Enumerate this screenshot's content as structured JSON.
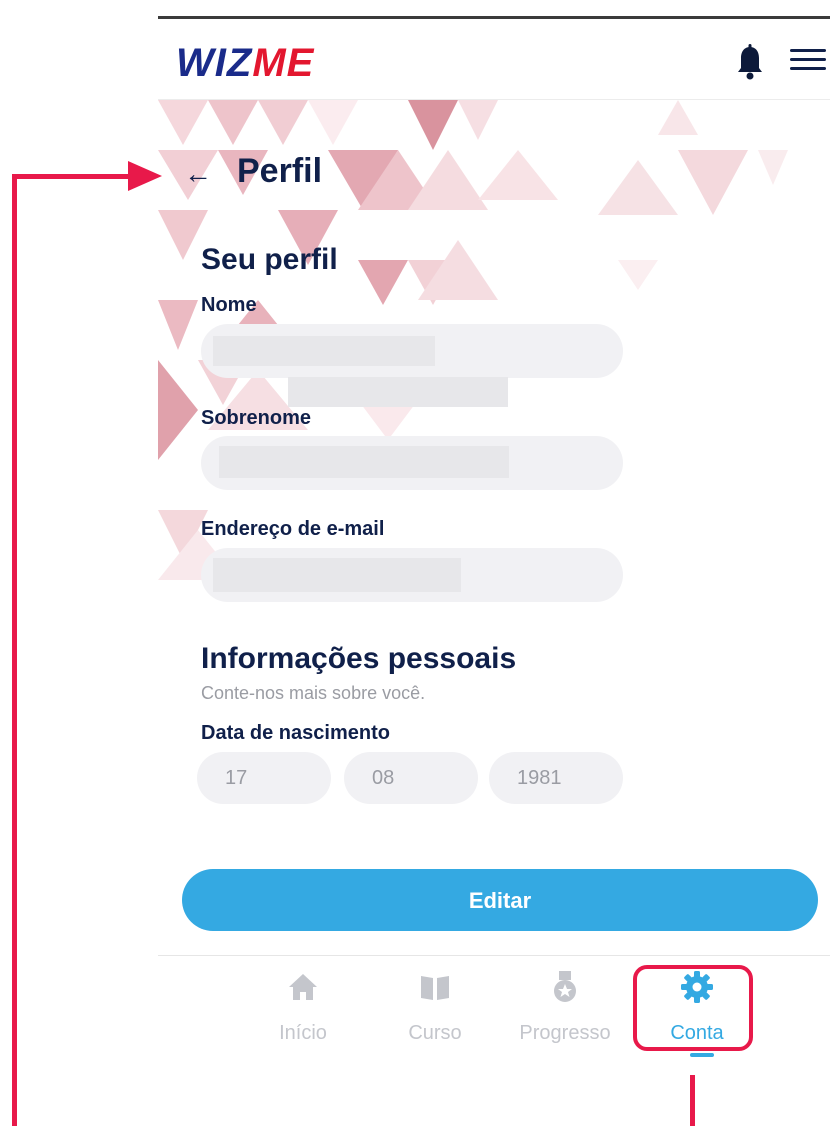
{
  "header": {
    "logo_part1": "WIZ",
    "logo_part2": "ME",
    "icons": [
      "bell-icon",
      "hamburger-menu-icon"
    ]
  },
  "page": {
    "back_icon": "←",
    "title": "Perfil"
  },
  "profile": {
    "heading": "Seu perfil",
    "first_name_label": "Nome",
    "last_name_label": "Sobrenome",
    "email_label": "Endereço de e-mail"
  },
  "personal": {
    "heading": "Informações pessoais",
    "subtitle": "Conte-nos mais sobre você.",
    "birth_label": "Data de nascimento",
    "day": "17",
    "month": "08",
    "year": "1981"
  },
  "edit_button": "Editar",
  "bottom_nav": {
    "items": [
      {
        "label": "Início",
        "icon": "home-icon"
      },
      {
        "label": "Curso",
        "icon": "book-icon"
      },
      {
        "label": "Progresso",
        "icon": "medal-icon"
      },
      {
        "label": "Conta",
        "icon": "gear-icon",
        "active": true
      }
    ]
  },
  "colors": {
    "accent": "#34a9e2",
    "navy": "#10204a",
    "brand_red": "#e3172f",
    "annotation": "#e8194a"
  }
}
